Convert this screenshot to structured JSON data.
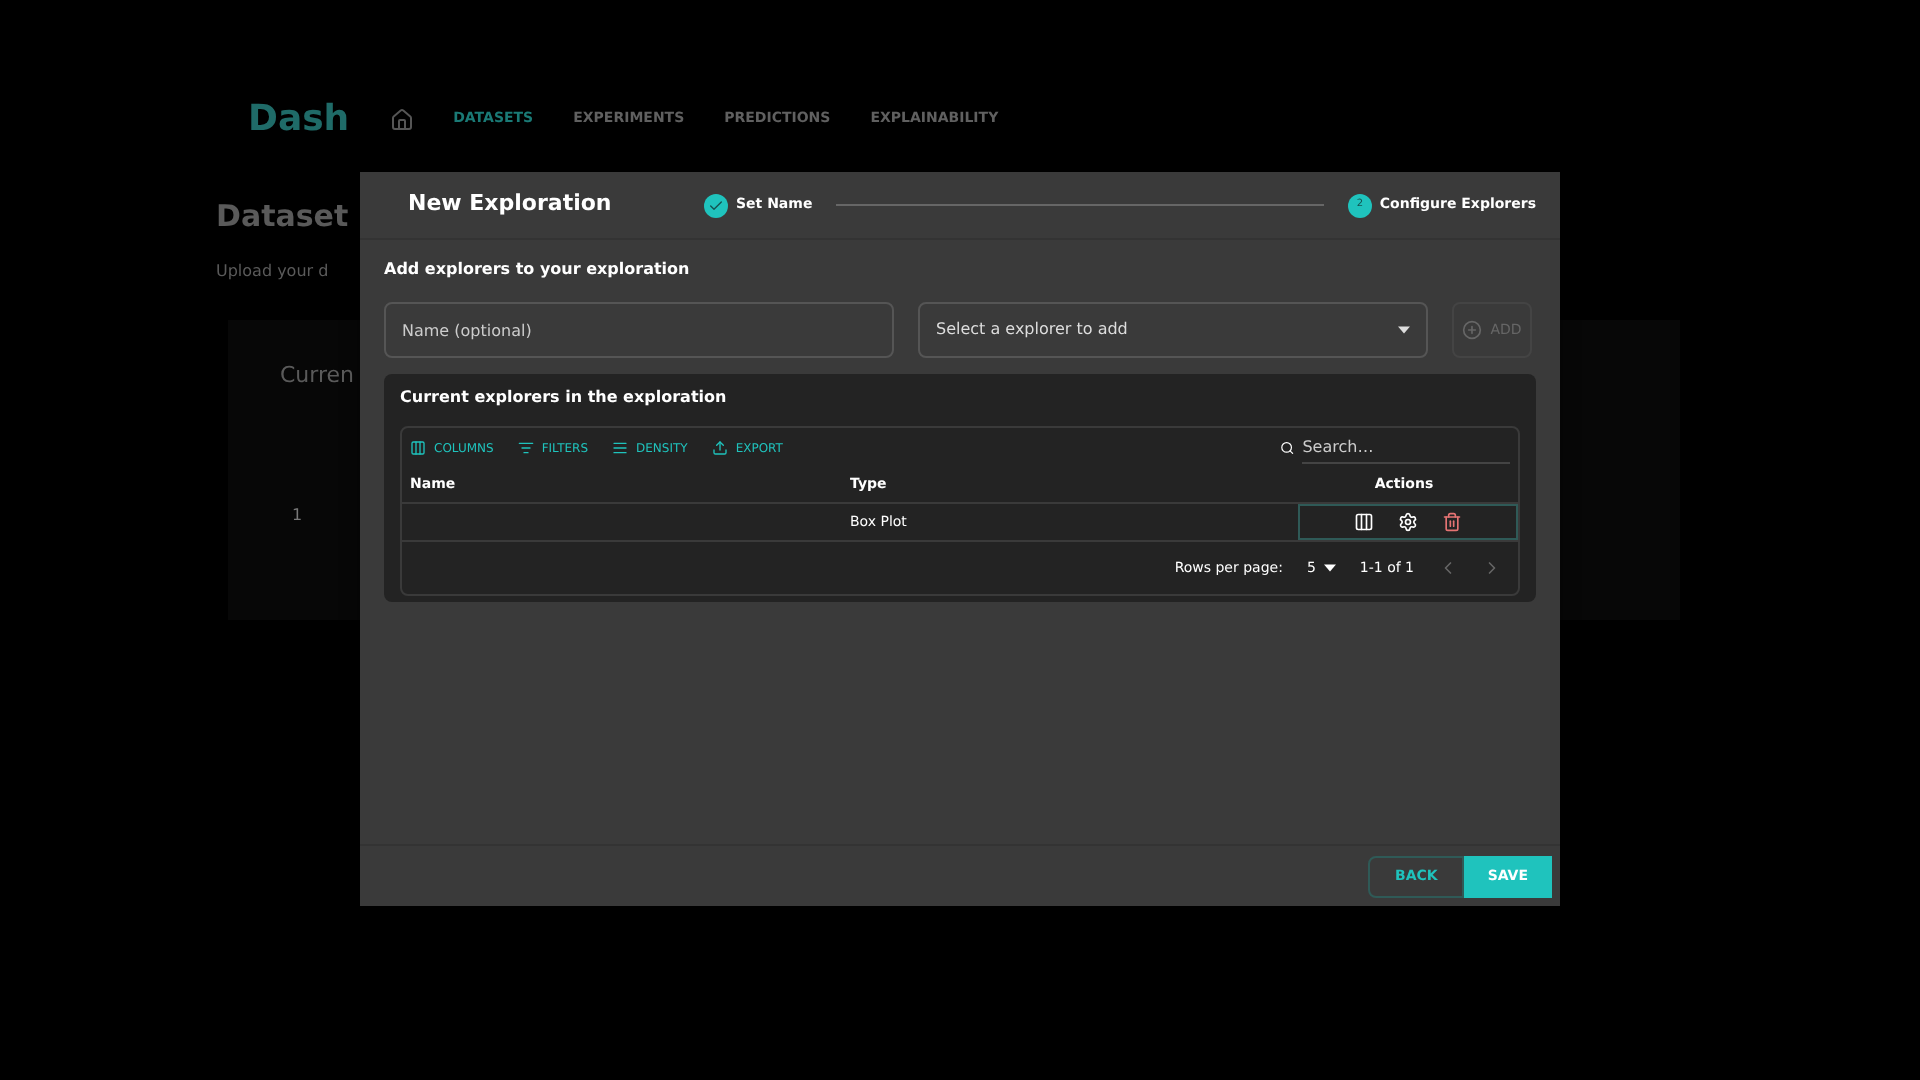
{
  "background": {
    "logo": "Dash",
    "nav": [
      {
        "label": "DATASETS",
        "selected": true
      },
      {
        "label": "EXPERIMENTS",
        "selected": false
      },
      {
        "label": "PREDICTIONS",
        "selected": false
      },
      {
        "label": "EXPLAINABILITY",
        "selected": false
      }
    ],
    "title": "Dataset",
    "subtitle": "Upload your d",
    "card_title": "Curren",
    "row_value": "1"
  },
  "dialog": {
    "title": "New Exploration",
    "steps": [
      {
        "label": "Set Name",
        "done": true
      },
      {
        "number": "2",
        "label": "Configure Explorers",
        "done": false
      }
    ],
    "heading": "Add explorers to your exploration",
    "name_field": {
      "placeholder": "Name (optional)"
    },
    "explorer_select": {
      "placeholder": "Select a explorer to add"
    },
    "add_button": {
      "label": "ADD",
      "disabled": true
    },
    "table_title": "Current explorers in the exploration",
    "toolbar": [
      {
        "kind": "columns",
        "label": "COLUMNS"
      },
      {
        "kind": "filters",
        "label": "FILTERS"
      },
      {
        "kind": "density",
        "label": "DENSITY"
      },
      {
        "kind": "export",
        "label": "EXPORT"
      }
    ],
    "search": {
      "placeholder": "Search…"
    },
    "columns": [
      "Name",
      "Type",
      "Actions"
    ],
    "rows": [
      {
        "name": "",
        "type": "Box Plot"
      }
    ],
    "pagination": {
      "label": "Rows per page:",
      "per_page": "5",
      "range": "1-1 of 1"
    },
    "buttons": [
      {
        "label": "BACK",
        "kind": "outline"
      },
      {
        "label": "SAVE",
        "kind": "primary"
      }
    ]
  }
}
